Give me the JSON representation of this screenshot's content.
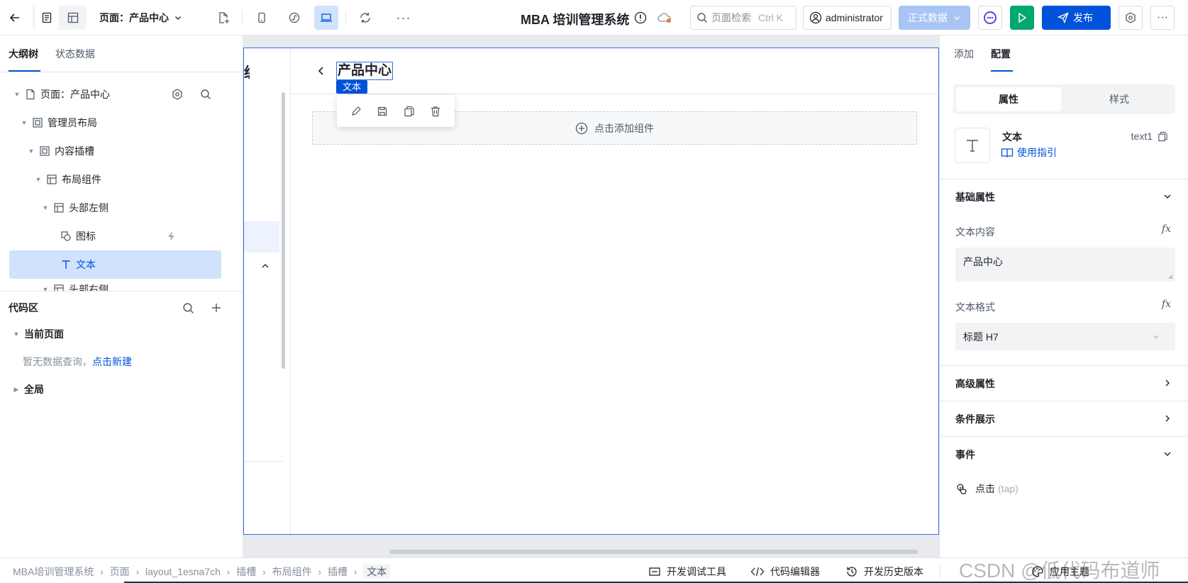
{
  "topbar": {
    "page_selector": "页面：产品中心",
    "app_title": "MBA 培训管理系统",
    "search_label": "页面检索",
    "search_shortcut": "Ctrl K",
    "user": "administrator",
    "env_label": "正式数据",
    "publish_label": "发布"
  },
  "left": {
    "tabs": [
      "大纲树",
      "状态数据"
    ],
    "tree": [
      {
        "label": "页面：产品中心",
        "icon": "page-icon"
      },
      {
        "label": "管理员布局",
        "icon": "layout-icon"
      },
      {
        "label": "内容插槽",
        "icon": "slot-icon"
      },
      {
        "label": "布局组件",
        "icon": "grid-icon"
      },
      {
        "label": "头部左侧",
        "icon": "grid-icon"
      },
      {
        "label": "图标",
        "icon": "icon-component-icon"
      },
      {
        "label": "文本",
        "icon": "text-t-icon"
      },
      {
        "label": "头部右侧",
        "icon": "grid-icon"
      }
    ],
    "code_area": {
      "title": "代码区",
      "current_page": "当前页面",
      "empty_text": "暂无数据查询，",
      "create_link": "点击新建",
      "global": "全局"
    }
  },
  "canvas": {
    "header_title": "产品中心",
    "selected_tag": "文本",
    "add_component": "点击添加组件",
    "left_fragment": "统"
  },
  "right": {
    "tabs": [
      "添加",
      "配置"
    ],
    "subtabs": [
      "属性",
      "样式"
    ],
    "component_name": "文本",
    "component_id": "text1",
    "guide_link": "使用指引",
    "basic_section": "基础属性",
    "text_content_label": "文本内容",
    "text_content_value": "产品中心",
    "text_format_label": "文本格式",
    "text_format_value": "标题 H7",
    "advanced_section": "高级属性",
    "condition_section": "条件展示",
    "events_section": "事件",
    "event_item": "点击",
    "event_item_hint": "(tap)",
    "fx": "fx"
  },
  "bottom": {
    "breadcrumbs": [
      "MBA培训管理系统",
      "页面",
      "layout_1esna7ch",
      "插槽",
      "布局组件",
      "插槽",
      "文本"
    ],
    "tools": [
      "开发调试工具",
      "代码编辑器",
      "开发历史版本",
      "应用主题"
    ],
    "watermark": "CSDN @低代码布道师"
  },
  "colors": {
    "primary": "#0052d9",
    "selection": "#d1e2fc",
    "run": "#00a870",
    "env": "#a8c4f5"
  }
}
